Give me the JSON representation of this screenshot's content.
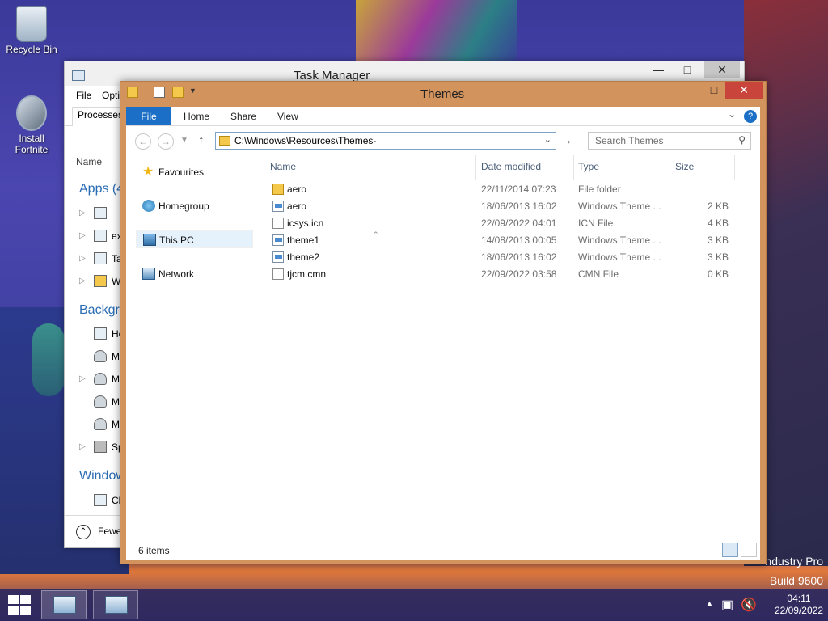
{
  "desktop": {
    "icons": [
      {
        "label": "Recycle Bin",
        "icon": "recycle-bin-icon"
      },
      {
        "label": "Install Fortnite",
        "icon": "install-disc-icon"
      }
    ],
    "branding_line1": "ndustry Pro",
    "branding_line2": "Build 9600"
  },
  "task_manager": {
    "title": "Task Manager",
    "menu": [
      "File",
      "Opti"
    ],
    "tab": "Processes",
    "column_name": "Name",
    "sections": [
      "Apps (4",
      "Backgro",
      "Window"
    ],
    "rows": [
      {
        "label": "",
        "icon": "app-icon"
      },
      {
        "label": "ex",
        "icon": "window-icon"
      },
      {
        "label": "Ta",
        "icon": "taskmgr-icon"
      },
      {
        "label": "W",
        "icon": "explorer-icon"
      },
      {
        "label": "Ho",
        "icon": "window-icon"
      },
      {
        "label": "M",
        "icon": "user-icon"
      },
      {
        "label": "M",
        "icon": "user-icon"
      },
      {
        "label": "M",
        "icon": "user-icon"
      },
      {
        "label": "M",
        "icon": "user-icon"
      },
      {
        "label": "Sp",
        "icon": "printer-icon"
      },
      {
        "label": "Cl",
        "icon": "window-icon"
      }
    ],
    "fewer_details": "Fewe"
  },
  "explorer": {
    "title": "Themes",
    "ribbon_tabs": [
      "File",
      "Home",
      "Share",
      "View"
    ],
    "address": "C:\\Windows\\Resources\\Themes-",
    "search_placeholder": "Search Themes",
    "nav": [
      "Favourites",
      "Homegroup",
      "This PC",
      "Network"
    ],
    "columns": {
      "name": "Name",
      "date": "Date modified",
      "type": "Type",
      "size": "Size"
    },
    "files": [
      {
        "name": "aero",
        "date": "22/11/2014 07:23",
        "type": "File folder",
        "size": "",
        "icon": "folder"
      },
      {
        "name": "aero",
        "date": "18/06/2013 16:02",
        "type": "Windows Theme ...",
        "size": "2 KB",
        "icon": "theme"
      },
      {
        "name": "icsys.icn",
        "date": "22/09/2022 04:01",
        "type": "ICN File",
        "size": "4 KB",
        "icon": "file"
      },
      {
        "name": "theme1",
        "date": "14/08/2013 00:05",
        "type": "Windows Theme ...",
        "size": "3 KB",
        "icon": "theme"
      },
      {
        "name": "theme2",
        "date": "18/06/2013 16:02",
        "type": "Windows Theme ...",
        "size": "3 KB",
        "icon": "theme"
      },
      {
        "name": "tjcm.cmn",
        "date": "22/09/2022 03:58",
        "type": "CMN File",
        "size": "0 KB",
        "icon": "file"
      }
    ],
    "status": "6 items"
  },
  "taskbar": {
    "time": "04:11",
    "date": "22/09/2022"
  }
}
